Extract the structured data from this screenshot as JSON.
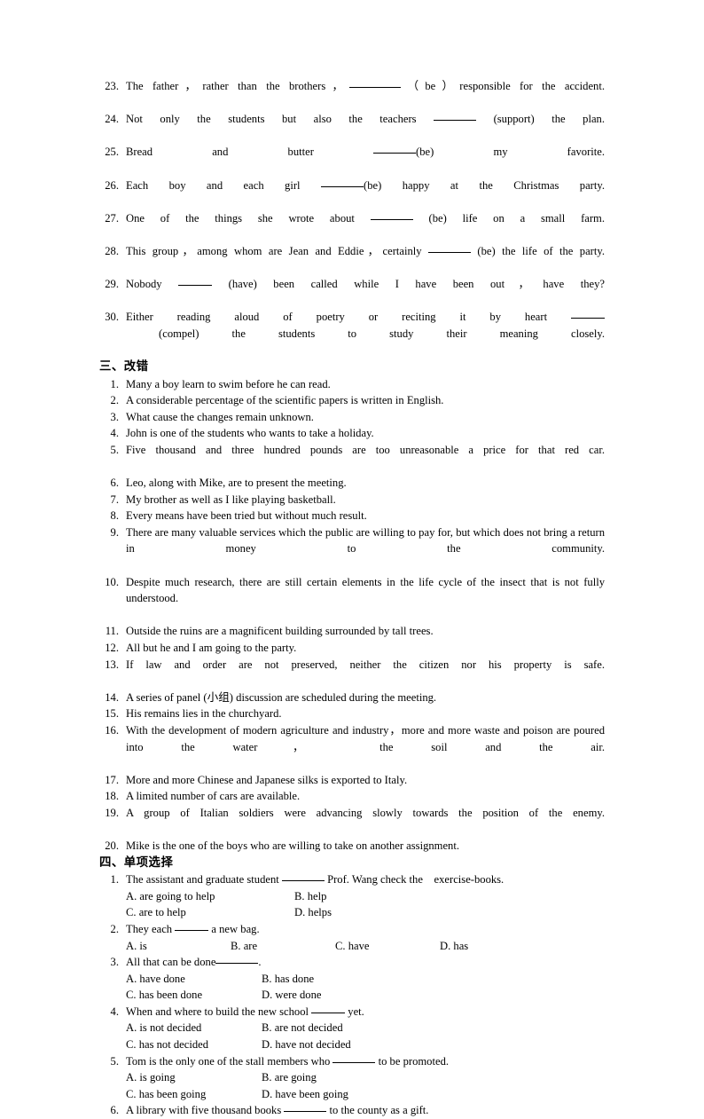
{
  "document": {
    "fill_in_items": [
      {
        "num": "23.",
        "parts": [
          {
            "t": "The father，rather than the brothers，"
          },
          {
            "blank": "l"
          },
          {
            "t": "（be）responsible for the accident."
          }
        ]
      },
      {
        "num": "24.",
        "parts": [
          {
            "t": "Not only the students but also the teachers "
          },
          {
            "blank": "m"
          },
          {
            "t": " (support) the plan."
          }
        ]
      },
      {
        "num": "25.",
        "parts": [
          {
            "t": "Bread and butter "
          },
          {
            "blank": "m"
          },
          {
            "t": "(be) my favorite."
          }
        ]
      },
      {
        "num": "26.",
        "parts": [
          {
            "t": "Each boy and each girl "
          },
          {
            "blank": "m"
          },
          {
            "t": "(be) happy at the Christmas party."
          }
        ]
      },
      {
        "num": "27.",
        "parts": [
          {
            "t": "One of the things she wrote about "
          },
          {
            "blank": "m"
          },
          {
            "t": " (be) life on a small farm."
          }
        ]
      },
      {
        "num": "28.",
        "parts": [
          {
            "t": "This group，among whom are Jean and Eddie，certainly "
          },
          {
            "blank": "m"
          },
          {
            "t": " (be) the life of the party."
          }
        ]
      },
      {
        "num": "29.",
        "parts": [
          {
            "t": "Nobody "
          },
          {
            "blank": "s"
          },
          {
            "t": " (have) been called while I have been out，have they?"
          }
        ]
      },
      {
        "num": "30.",
        "parts": [
          {
            "t": "Either reading aloud of poetry or reciting it by heart "
          },
          {
            "blank": "s"
          },
          {
            "t": " (compel) the students to study their meaning closely."
          }
        ]
      }
    ],
    "section_three": {
      "heading": "三、改错",
      "items": [
        {
          "num": "1.",
          "text": "Many a boy learn to swim before he can read."
        },
        {
          "num": "2.",
          "text": "A considerable percentage of the scientific papers is written in English."
        },
        {
          "num": "3.",
          "text": "What cause the changes remain unknown."
        },
        {
          "num": "4.",
          "text": "John is one of the students who wants to take a holiday."
        },
        {
          "num": "5.",
          "text": "Five thousand and three hundred pounds are too unreasonable a price for that red car."
        },
        {
          "num": "6.",
          "text": "Leo, along with Mike, are to present the meeting."
        },
        {
          "num": "7.",
          "text": "My brother as well as I like playing basketball."
        },
        {
          "num": "8.",
          "text": "Every means have been tried but without much result."
        },
        {
          "num": "9.",
          "text": "There are many valuable services which the public are willing to pay for, but which does not bring a return in money to the community."
        },
        {
          "num": "10.",
          "text": "Despite much research, there are still certain elements in the life cycle of the insect that is not fully understood."
        },
        {
          "num": "11.",
          "text": "Outside the ruins are a magnificent building surrounded by tall trees."
        },
        {
          "num": "12.",
          "text": "All but he and I am going to the party."
        },
        {
          "num": "13.",
          "text": "If law and order are not preserved, neither the citizen nor his property is safe."
        },
        {
          "num": "14.",
          "text": "A series of panel (小组) discussion are scheduled during the meeting."
        },
        {
          "num": "15.",
          "text": "His remains lies in the churchyard."
        },
        {
          "num": "16.",
          "text": "With the development of modern agriculture and industry，more and more waste and poison are poured into the water，　the soil and the air."
        },
        {
          "num": "17.",
          "text": "More and more Chinese and Japanese silks is exported to Italy."
        },
        {
          "num": "18.",
          "text": "A limited number of cars are available."
        },
        {
          "num": "19.",
          "text": "A group of Italian soldiers were advancing slowly towards the position of the enemy."
        },
        {
          "num": "20.",
          "text": "Mike is the one of the boys who are willing to take on another assignment."
        }
      ]
    },
    "section_four": {
      "heading": "四、单项选择",
      "questions": [
        {
          "num": "1.",
          "layout": "cols-wide",
          "parts": [
            {
              "t": "The assistant and graduate student "
            },
            {
              "blank": "m"
            },
            {
              "t": " Prof. Wang check the　exercise-books."
            }
          ],
          "options": [
            "A. are going to help",
            "B. help",
            "C. are to help",
            "D. helps"
          ]
        },
        {
          "num": "2.",
          "layout": "cols-four",
          "parts": [
            {
              "t": "They each "
            },
            {
              "blank": "s"
            },
            {
              "t": " a new bag."
            }
          ],
          "options": [
            "A. is",
            "B. are",
            "C. have",
            "D. has"
          ]
        },
        {
          "num": "3.",
          "layout": "cols-std",
          "parts": [
            {
              "t": "All that can be done"
            },
            {
              "blank": "m"
            },
            {
              "t": "."
            }
          ],
          "options": [
            "A. have done",
            "B. has done",
            "C. has been done",
            "D. were done"
          ]
        },
        {
          "num": "4.",
          "layout": "cols-std",
          "parts": [
            {
              "t": "When and where to build the new school "
            },
            {
              "blank": "s"
            },
            {
              "t": " yet."
            }
          ],
          "options": [
            "A. is not decided",
            "B. are not decided",
            "C. has not decided",
            "D. have not decided"
          ]
        },
        {
          "num": "5.",
          "layout": "cols-std",
          "parts": [
            {
              "t": "Tom is the only one of the stall members who "
            },
            {
              "blank": "m"
            },
            {
              "t": " to be promoted."
            }
          ],
          "options": [
            "A. is going",
            "B. are going",
            "C. has been going",
            "D. have been going"
          ]
        },
        {
          "num": "6.",
          "layout": "cols-std",
          "parts": [
            {
              "t": "A library with five thousand books "
            },
            {
              "blank": "m"
            },
            {
              "t": " to the county as a gift."
            }
          ],
          "options": []
        }
      ]
    }
  }
}
